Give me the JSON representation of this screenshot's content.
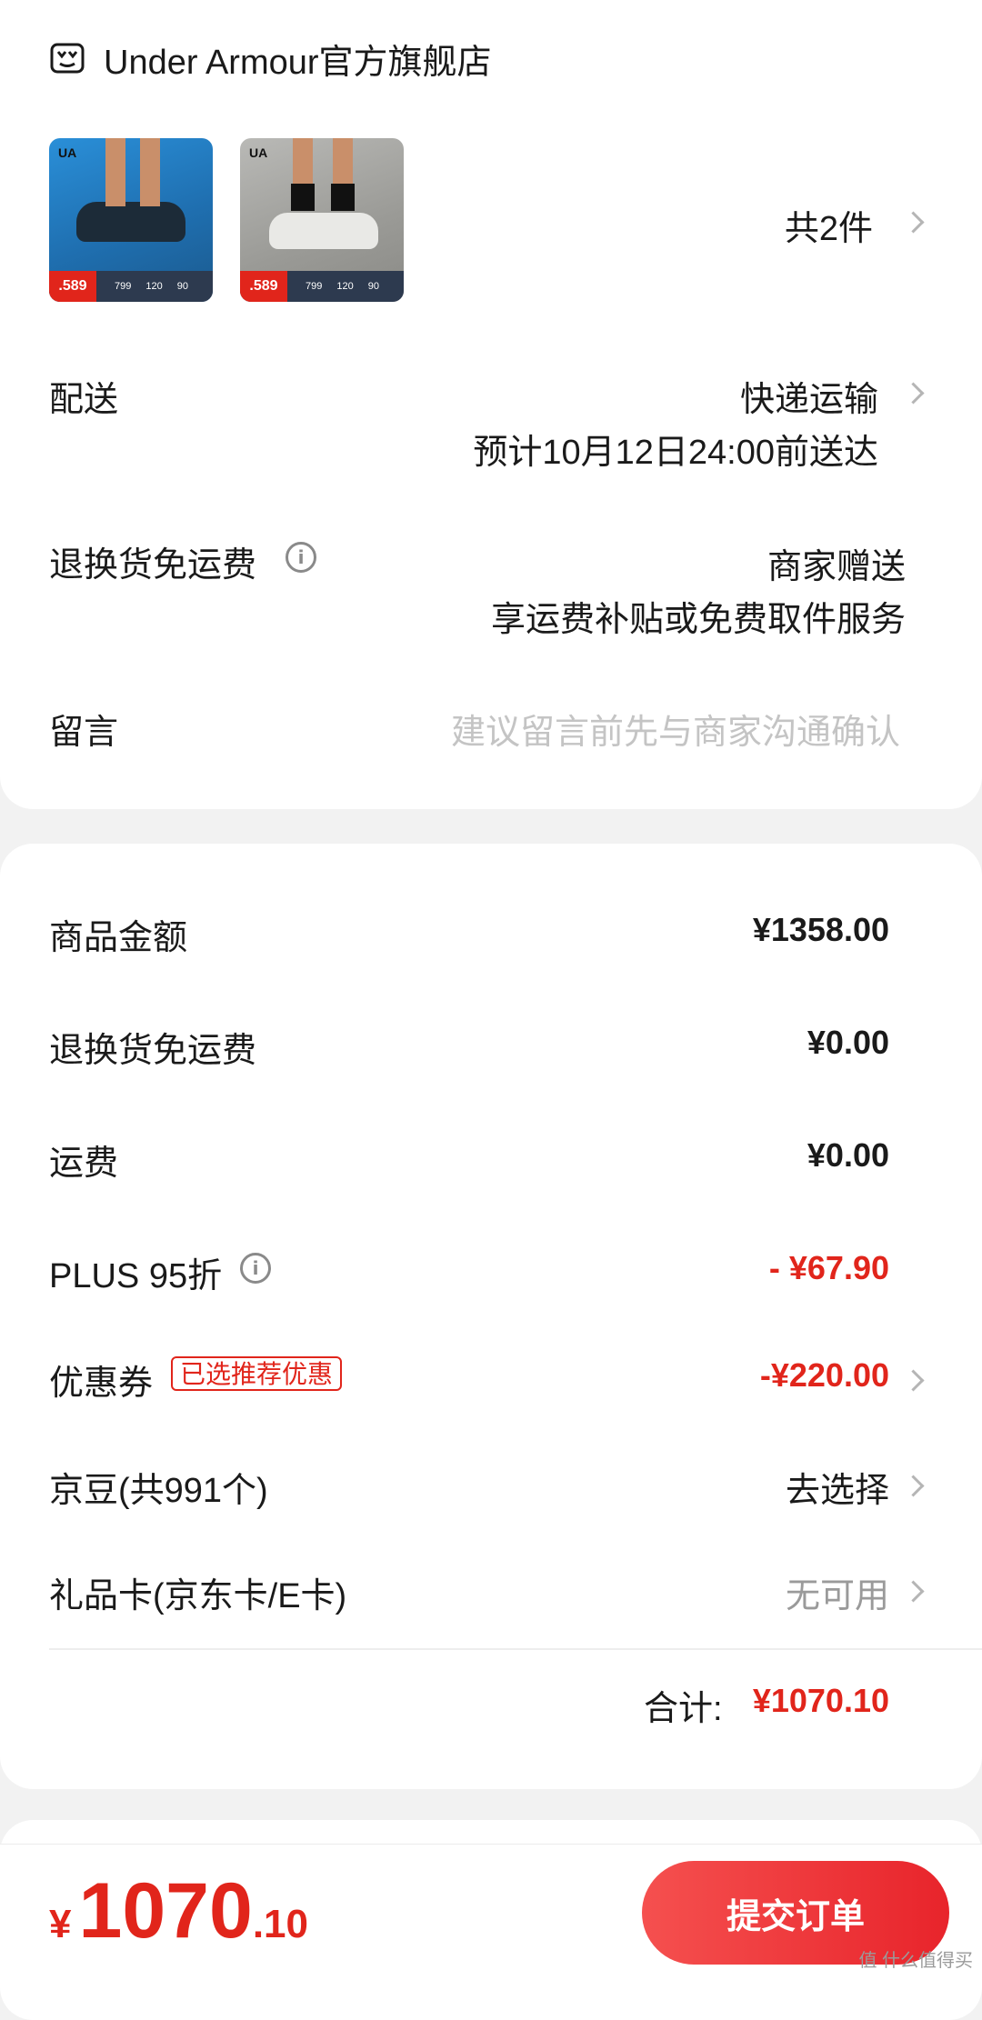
{
  "store": {
    "name": "Under Armour官方旗舰店",
    "icon": "store-icon"
  },
  "products": {
    "count_label": "共2件",
    "items": [
      {
        "price_badge": ".589",
        "stats": [
          "799",
          "120",
          "90"
        ]
      },
      {
        "price_badge": ".589",
        "stats": [
          "799",
          "120",
          "90"
        ]
      }
    ]
  },
  "delivery": {
    "label": "配送",
    "method": "快递运输",
    "eta": "预计10月12日24:00前送达"
  },
  "return_shipping": {
    "label": "退换货免运费",
    "value": "商家赠送",
    "desc": "享运费补贴或免费取件服务"
  },
  "message": {
    "label": "留言",
    "placeholder": "建议留言前先与商家沟通确认"
  },
  "summary": {
    "goods_amount": {
      "label": "商品金额",
      "value": "¥1358.00"
    },
    "return_fee": {
      "label": "退换货免运费",
      "value": "¥0.00"
    },
    "shipping": {
      "label": "运费",
      "value": "¥0.00"
    },
    "plus_discount": {
      "label": "PLUS 95折",
      "value": "- ¥67.90"
    },
    "coupon": {
      "label": "优惠券",
      "tag": "已选推荐优惠",
      "value": "-¥220.00"
    },
    "jingdou": {
      "label": "京豆(共991个)",
      "value": "去选择"
    },
    "giftcard": {
      "label": "礼品卡(京东卡/E卡)",
      "value": "无可用"
    },
    "total_label": "合计:",
    "total_value": "¥1070.10"
  },
  "footer": {
    "currency": "¥",
    "amount_int": "1070",
    "amount_dec": ".10",
    "submit_label": "提交订单",
    "watermark": "值 什么值得买"
  },
  "colors": {
    "accent_red": "#e1251b",
    "button_start": "#f5504f",
    "button_end": "#e8242b"
  }
}
